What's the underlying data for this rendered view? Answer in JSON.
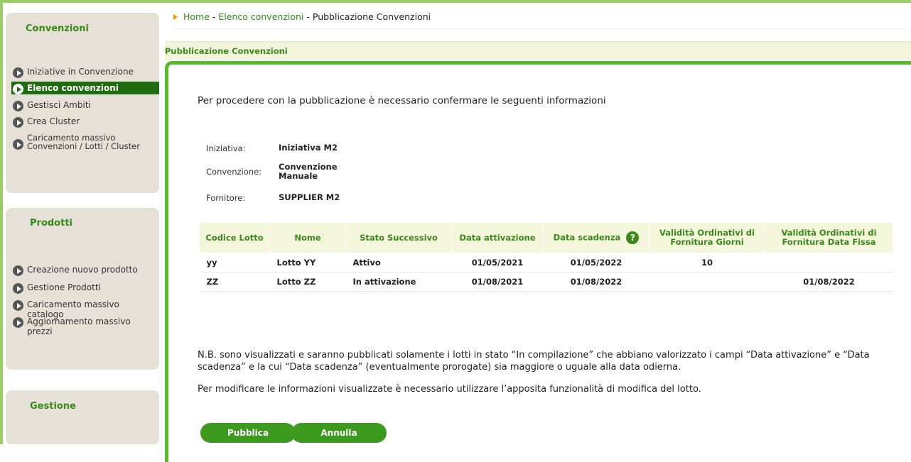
{
  "sidebar": {
    "convenzioni": {
      "title": "Convenzioni",
      "items": [
        {
          "label": "Iniziative in Convenzione"
        },
        {
          "label": "Elenco convenzioni"
        },
        {
          "label": "Gestisci Ambiti"
        },
        {
          "label": "Crea Cluster"
        },
        {
          "label": "Caricamento massivo Convenzioni / Lotti / Cluster"
        }
      ]
    },
    "prodotti": {
      "title": "Prodotti",
      "items": [
        {
          "label": "Creazione nuovo prodotto"
        },
        {
          "label": "Gestione Prodotti"
        },
        {
          "label": "Caricamento massivo catalogo"
        },
        {
          "label": "Aggiornamento massivo prezzi"
        }
      ]
    },
    "gestione": {
      "title": "Gestione"
    }
  },
  "breadcrumb": {
    "home": "Home",
    "sep": " - ",
    "elenco": "Elenco convenzioni",
    "current": "Pubblicazione Convenzioni"
  },
  "section": {
    "title": "Pubblicazione Convenzioni"
  },
  "intro": "Per procedere con la pubblicazione è necessario confermare le seguenti informazioni",
  "info": {
    "iniziativa_label": "Iniziativa:",
    "iniziativa_value": "Iniziativa M2",
    "convenzione_label": "Convenzione:",
    "convenzione_value": "Convenzione Manuale",
    "fornitore_label": "Fornitore:",
    "fornitore_value": "SUPPLIER M2"
  },
  "table": {
    "headers": [
      "Codice Lotto",
      "Nome",
      "Stato Successivo",
      "Data attivazione",
      "Data scadenza",
      "Validità Ordinativi di Fornitura Giorni",
      "Validità Ordinativi di Fornitura Data Fissa"
    ],
    "help_icon": "?",
    "rows": [
      [
        "yy",
        "Lotto YY",
        "Attivo",
        "01/05/2021",
        "01/05/2022",
        "10",
        ""
      ],
      [
        "ZZ",
        "Lotto ZZ",
        "In attivazione",
        "01/08/2021",
        "01/08/2022",
        "",
        "01/08/2022"
      ]
    ]
  },
  "note": "N.B. sono visualizzati e saranno pubblicati solamente i lotti in stato “In compilazione” che abbiano valorizzato i campi “Data attivazione” e “Data scadenza” e la cui “Data scadenza” (eventualmente prorogate) sia maggiore o uguale alla data odierna.",
  "note2": "Per modificare le informazioni visualizzate è necessario utilizzare l’apposita funzionalità di modifica del lotto.",
  "buttons": {
    "pubblica": "Pubblica",
    "annulla": "Annulla"
  }
}
